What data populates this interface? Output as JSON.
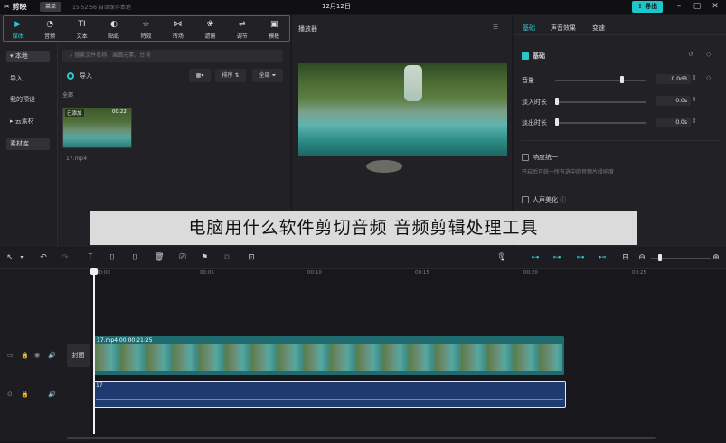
{
  "titlebar": {
    "app_name": "剪映",
    "menu_label": "菜单",
    "autosave": "15:52:56 自动保存本地",
    "date": "12月12日",
    "export_label": "导出"
  },
  "toolbar": {
    "items": [
      {
        "label": "媒体",
        "icon": "media-icon"
      },
      {
        "label": "音频",
        "icon": "audio-icon"
      },
      {
        "label": "文本",
        "icon": "text-icon"
      },
      {
        "label": "贴纸",
        "icon": "sticker-icon"
      },
      {
        "label": "特效",
        "icon": "effects-icon"
      },
      {
        "label": "转场",
        "icon": "transition-icon"
      },
      {
        "label": "滤镜",
        "icon": "filter-icon"
      },
      {
        "label": "调节",
        "icon": "adjust-icon"
      },
      {
        "label": "模板",
        "icon": "template-icon"
      }
    ],
    "active_index": 0,
    "highlight_color": "#e0252b"
  },
  "leftnav": {
    "items": [
      "▾ 本地",
      "导入",
      "我的预设",
      "▸ 云素材",
      "素材库"
    ]
  },
  "media": {
    "search_placeholder": "搜索文件名称、画面元素、台词",
    "import_label": "导入",
    "sort_label": "排序",
    "filter_label": "全部",
    "section_label": "全部",
    "clip": {
      "tag": "已添加",
      "duration": "00:22",
      "name": "17.mp4"
    }
  },
  "player": {
    "title": "播放器"
  },
  "properties": {
    "tabs": [
      "基础",
      "声音效果",
      "变速"
    ],
    "active_tab": 0,
    "section_basic": "基础",
    "rows": [
      {
        "label": "音量",
        "value": "0.0dB"
      },
      {
        "label": "淡入时长",
        "value": "0.0s"
      },
      {
        "label": "淡出时长",
        "value": "0.0s"
      }
    ],
    "loudness_label": "响度统一",
    "loudness_desc": "开启后可统一所有选中的音频片段响度",
    "voice_label": "人声美化"
  },
  "caption": "电脑用什么软件剪切音频 音频剪辑处理工具",
  "timeline": {
    "ticks": [
      "00:00",
      "00:05",
      "00:10",
      "00:15",
      "00:20",
      "00:25"
    ],
    "cover_label": "封面",
    "video_clip_title": "17.mp4   00:00:21:25",
    "audio_clip_title": "17"
  },
  "colors": {
    "accent": "#29c8cc",
    "video_clip": "#1f6b70",
    "audio_clip": "#1e3a6e"
  }
}
